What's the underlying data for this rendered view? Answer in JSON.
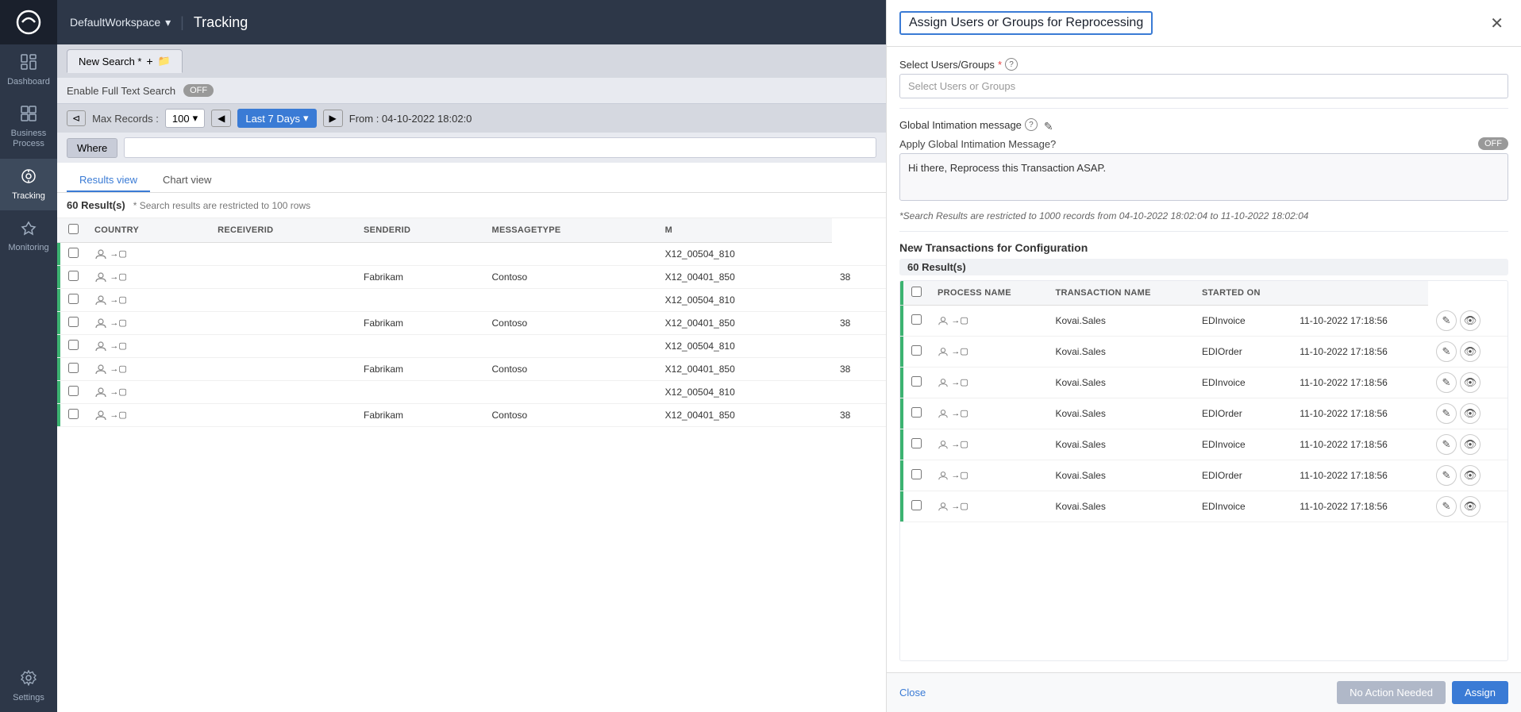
{
  "sidebar": {
    "logo": "◎",
    "items": [
      {
        "id": "dashboard",
        "label": "Dashboard",
        "icon": "📊"
      },
      {
        "id": "business-process",
        "label": "Business Process",
        "icon": "▦"
      },
      {
        "id": "tracking",
        "label": "Tracking",
        "icon": "⊙"
      },
      {
        "id": "monitoring",
        "label": "Monitoring",
        "icon": "♡"
      },
      {
        "id": "settings",
        "label": "Settings",
        "icon": "⚙"
      }
    ]
  },
  "topbar": {
    "workspace": "DefaultWorkspace",
    "title": "Tracking"
  },
  "search": {
    "tab_label": "New Search",
    "tab_asterisk": "*",
    "enable_text_label": "Enable Full Text Search",
    "toggle_state": "OFF",
    "max_records_label": "Max Records :",
    "max_records_value": "100",
    "date_range": "Last 7 Days",
    "from_label": "From : 04-10-2022 18:02:0",
    "where_label": "Where"
  },
  "results": {
    "count": "60",
    "results_label": "Result(s)",
    "note": "* Search results are restricted to 100 rows",
    "view_tabs": [
      "Results view",
      "Chart view"
    ],
    "active_view": "Results view",
    "columns": [
      "COUNTRY",
      "RECEIVERID",
      "SENDERID",
      "MESSAGETYPE",
      "M"
    ],
    "rows": [
      {
        "country": "",
        "receiverid": "",
        "senderid": "",
        "messagetype": "X12_00504_810",
        "m": ""
      },
      {
        "country": "",
        "receiverid": "Fabrikam",
        "senderid": "Contoso",
        "messagetype": "X12_00401_850",
        "m": "38"
      },
      {
        "country": "",
        "receiverid": "",
        "senderid": "",
        "messagetype": "X12_00504_810",
        "m": ""
      },
      {
        "country": "",
        "receiverid": "Fabrikam",
        "senderid": "Contoso",
        "messagetype": "X12_00401_850",
        "m": "38"
      },
      {
        "country": "",
        "receiverid": "",
        "senderid": "",
        "messagetype": "X12_00504_810",
        "m": ""
      },
      {
        "country": "",
        "receiverid": "Fabrikam",
        "senderid": "Contoso",
        "messagetype": "X12_00401_850",
        "m": "38"
      },
      {
        "country": "",
        "receiverid": "",
        "senderid": "",
        "messagetype": "X12_00504_810",
        "m": ""
      },
      {
        "country": "",
        "receiverid": "Fabrikam",
        "senderid": "Contoso",
        "messagetype": "X12_00401_850",
        "m": "38"
      }
    ]
  },
  "panel": {
    "title": "Assign Users or Groups for Reprocessing",
    "close_label": "✕",
    "select_users_label": "Select Users/Groups",
    "select_users_placeholder": "Select Users or Groups",
    "global_intimation_label": "Global Intimation message",
    "apply_global_label": "Apply Global Intimation Message?",
    "apply_toggle": "OFF",
    "message_text": "Hi there, Reprocess this Transaction ASAP.",
    "restriction_note": "*Search Results are restricted to 1000 records from 04-10-2022 18:02:04 to 11-10-2022 18:02:04",
    "new_transactions_title": "New Transactions for Configuration",
    "results_count": "60 Result(s)",
    "columns": [
      "PROCESS NAME",
      "TRANSACTION NAME",
      "STARTED ON"
    ],
    "rows": [
      {
        "process": "Kovai.Sales",
        "transaction": "EDInvoice",
        "started": "11-10-2022 17:18:56"
      },
      {
        "process": "Kovai.Sales",
        "transaction": "EDIOrder",
        "started": "11-10-2022 17:18:56"
      },
      {
        "process": "Kovai.Sales",
        "transaction": "EDInvoice",
        "started": "11-10-2022 17:18:56"
      },
      {
        "process": "Kovai.Sales",
        "transaction": "EDIOrder",
        "started": "11-10-2022 17:18:56"
      },
      {
        "process": "Kovai.Sales",
        "transaction": "EDInvoice",
        "started": "11-10-2022 17:18:56"
      },
      {
        "process": "Kovai.Sales",
        "transaction": "EDIOrder",
        "started": "11-10-2022 17:18:56"
      },
      {
        "process": "Kovai.Sales",
        "transaction": "EDInvoice",
        "started": "11-10-2022 17:18:56"
      }
    ],
    "footer": {
      "close_label": "Close",
      "no_action_label": "No Action Needed",
      "assign_label": "Assign"
    }
  }
}
